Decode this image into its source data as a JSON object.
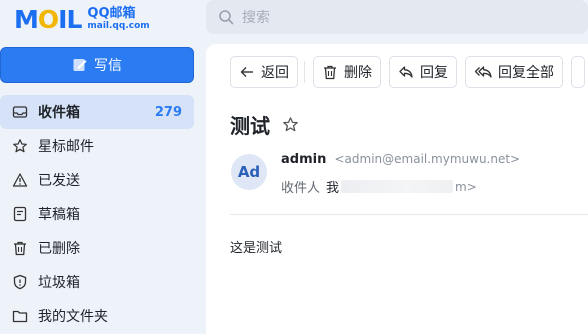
{
  "header": {
    "logo_text": "MOIL",
    "brand": "QQ邮箱",
    "domain": "mail.qq.com",
    "search_placeholder": "搜索"
  },
  "sidebar": {
    "compose_label": "写信",
    "items": [
      {
        "label": "收件箱",
        "count": "279",
        "icon": "inbox-icon",
        "active": true
      },
      {
        "label": "星标邮件",
        "icon": "star-icon"
      },
      {
        "label": "已发送",
        "icon": "sent-icon"
      },
      {
        "label": "草稿箱",
        "icon": "draft-icon"
      },
      {
        "label": "已删除",
        "icon": "trash-icon"
      },
      {
        "label": "垃圾箱",
        "icon": "spam-shield-icon"
      },
      {
        "label": "我的文件夹",
        "icon": "folder-icon"
      }
    ]
  },
  "toolbar": {
    "back_label": "返回",
    "delete_label": "删除",
    "reply_label": "回复",
    "reply_all_label": "回复全部"
  },
  "message": {
    "subject": "测试",
    "avatar_initials": "Ad",
    "sender_name": "admin",
    "sender_address": "<admin@email.mymuwu.net>",
    "recipient_prefix": "收件人",
    "recipient_name": "我",
    "recipient_tail": "m>",
    "body": "这是测试"
  },
  "colors": {
    "accent": "#2b7cf2",
    "sidebar_bg": "#eef2f9",
    "active_item_bg": "#d6e2f7"
  }
}
